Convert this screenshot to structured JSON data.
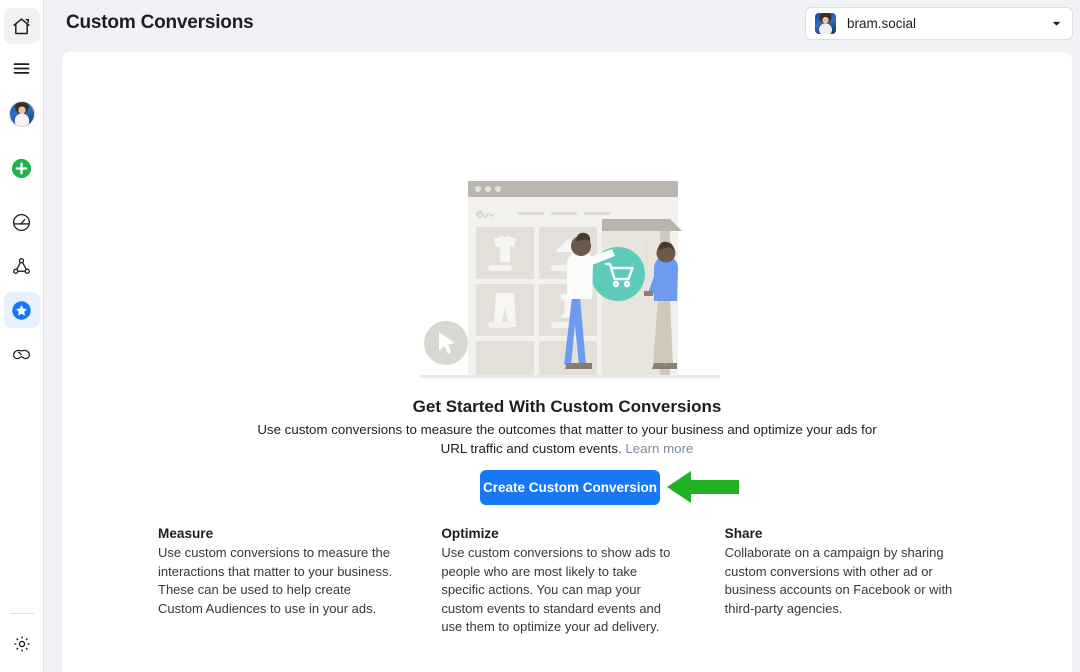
{
  "header": {
    "title": "Custom Conversions",
    "account": {
      "name": "bram.social",
      "avatar_icon": "user-avatar",
      "chevron_icon": "chevron-down-icon"
    }
  },
  "sidebar": {
    "items": [
      {
        "name": "home",
        "icon": "home-icon",
        "active": true
      },
      {
        "name": "menu",
        "icon": "hamburger-menu-icon",
        "active": false
      },
      {
        "name": "profile",
        "icon": "user-avatar-icon",
        "active": false
      },
      {
        "name": "create",
        "icon": "plus-circle-icon",
        "active": false
      },
      {
        "name": "performance",
        "icon": "gauge-icon",
        "active": false
      },
      {
        "name": "audiences",
        "icon": "network-nodes-icon",
        "active": false
      },
      {
        "name": "custom-conversions",
        "icon": "star-circle-icon",
        "active": true
      },
      {
        "name": "partnerships",
        "icon": "handshake-icon",
        "active": false
      },
      {
        "name": "settings",
        "icon": "gear-icon",
        "active": false
      }
    ]
  },
  "hero": {
    "title": "Get Started With Custom Conversions",
    "description": "Use custom conversions to measure the outcomes that matter to your business and optimize your ads for URL traffic and custom events.",
    "learn_more_label": "Learn more",
    "cta_label": "Create Custom Conversion"
  },
  "illustration": {
    "name": "storefront-shopping-illustration",
    "cart_badge_icon": "shopping-cart-icon",
    "cursor_icon": "cursor-arrow-icon"
  },
  "features": [
    {
      "title": "Measure",
      "body": "Use custom conversions to measure the interactions that matter to your business. These can be used to help create Custom Audiences to use in your ads."
    },
    {
      "title": "Optimize",
      "body": "Use custom conversions to show ads to people who are most likely to take specific actions. You can map your custom events to standard events and use them to optimize your ad delivery."
    },
    {
      "title": "Share",
      "body": "Collaborate on a campaign by sharing custom conversions with other ad or business accounts on Facebook or with third-party agencies."
    }
  ],
  "annotation": {
    "arrow_icon": "green-arrow-left-icon",
    "color": "#22b122"
  },
  "colors": {
    "page_background": "#f0f2f5",
    "card_background": "#ffffff",
    "primary_button": "#1877f2",
    "active_item": "#e7f0fd",
    "accent_teal": "#5dcbb8",
    "link": "#7a8b9c"
  }
}
